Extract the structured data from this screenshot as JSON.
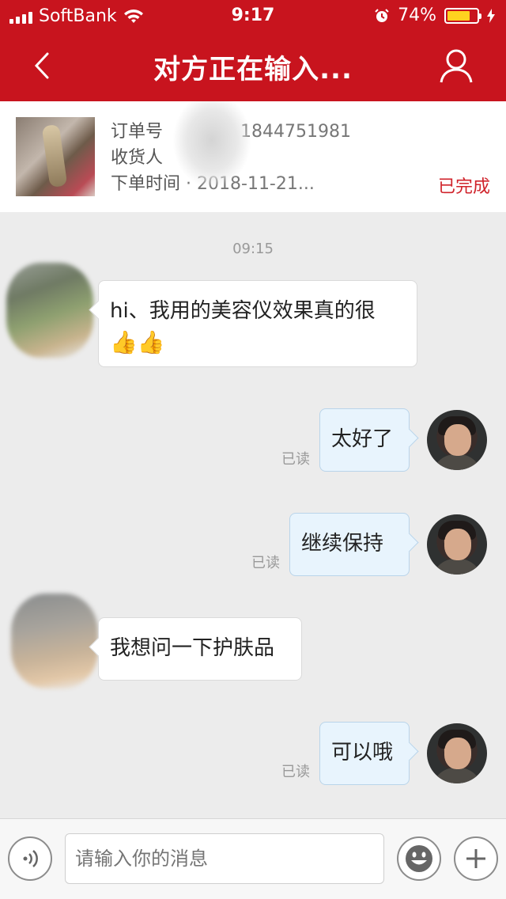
{
  "status_bar": {
    "carrier": "SoftBank",
    "time": "9:17",
    "battery": "74%"
  },
  "nav": {
    "title": "对方正在输入..."
  },
  "order": {
    "order_no_label": "订单号",
    "order_no_value": "1844751981",
    "receiver_label": "收货人",
    "order_time_label": "下单时间",
    "order_time_value": "2018-11-21...",
    "status": "已完成"
  },
  "chat": {
    "time": "09:15",
    "messages": [
      {
        "side": "in",
        "text": "hi、我用的美容仪效果真的很",
        "emoji": "👍👍"
      },
      {
        "side": "out",
        "text": "太好了",
        "read": "已读"
      },
      {
        "side": "out",
        "text": "继续保持",
        "read": "已读"
      },
      {
        "side": "in",
        "text": "我想问一下护肤品"
      },
      {
        "side": "out",
        "text": "可以哦",
        "read": "已读"
      }
    ]
  },
  "input_bar": {
    "placeholder": "请输入你的消息"
  },
  "colors": {
    "brand_red": "#c8141e",
    "status_red": "#d0232b",
    "outgoing_bubble": "#e8f4fd",
    "battery_yellow": "#ffd21f"
  }
}
